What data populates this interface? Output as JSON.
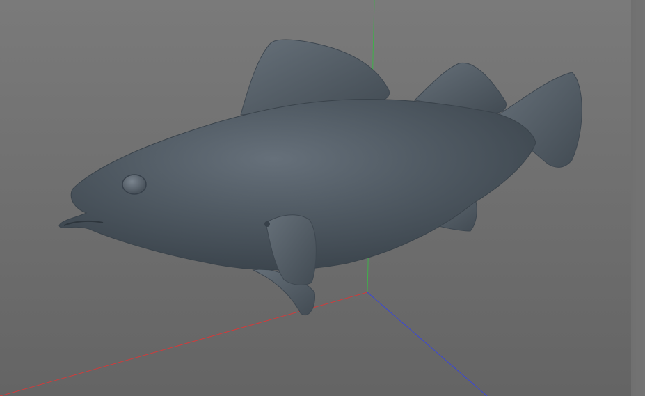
{
  "viewport": {
    "background_top": "#7d7d7d",
    "background_bottom": "#5f5f5f",
    "model_color": "#4f5861"
  },
  "axes": {
    "x_color": "#d23b3b",
    "y_color": "#3fb04a",
    "z_color": "#3b47d6"
  }
}
